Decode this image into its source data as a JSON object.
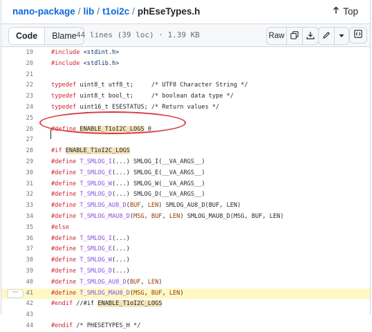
{
  "breadcrumb": {
    "parts": [
      "nano-package",
      "lib",
      "t1oi2c"
    ],
    "file": "phEseTypes.h",
    "separator": "/",
    "top_label": "Top"
  },
  "toolbar": {
    "code_tab": "Code",
    "blame_tab": "Blame",
    "meta": "44 lines (39 loc) · 1.39 KB",
    "raw_label": "Raw",
    "icons": [
      "copy-icon",
      "download-icon",
      "edit-icon",
      "chevron-down-icon",
      "symbols-panel-icon"
    ]
  },
  "code": {
    "line_numbers": [
      "19",
      "20",
      "21",
      "22",
      "23",
      "24",
      "25",
      "26",
      "27",
      "28",
      "29",
      "30",
      "31",
      "32",
      "33",
      "34",
      "35",
      "36",
      "37",
      "38",
      "39",
      "40",
      "41",
      "42",
      "43",
      "44"
    ],
    "highlighted_line": "41",
    "lines": [
      "#include <stdint.h>",
      "#include <stdlib.h>",
      "",
      "typedef uint8_t utf8_t;     /* UTF8 Character String */",
      "typedef uint8_t bool_t;     /* boolean data type */",
      "typedef uint16_t ESESTATUS; /* Return values */",
      "",
      "#define ENABLE_T1oI2C_LOGS 0",
      "",
      "#if ENABLE_T1oI2C_LOGS",
      "#define T_SMLOG_I(...) SMLOG_I(__VA_ARGS__)",
      "#define T_SMLOG_E(...) SMLOG_E(__VA_ARGS__)",
      "#define T_SMLOG_W(...) SMLOG_W(__VA_ARGS__)",
      "#define T_SMLOG_D(...) SMLOG_D(__VA_ARGS__)",
      "#define T_SMLOG_AU8_D(BUF, LEN) SMLOG_AU8_D(BUF, LEN)",
      "#define T_SMLOG_MAU8_D(MSG, BUF, LEN) SMLOG_MAU8_D(MSG, BUF, LEN)",
      "#else",
      "#define T_SMLOG_I(...)",
      "#define T_SMLOG_E(...)",
      "#define T_SMLOG_W(...)",
      "#define T_SMLOG_D(...)",
      "#define T_SMLOG_AU8_D(BUF, LEN)",
      "#define T_SMLOG_MAU8_D(MSG, BUF, LEN)",
      "#endif //#if ENABLE_T1oI2C_LOGS",
      "",
      "#endif /* PHESETYPES_H */"
    ],
    "more_button": "···"
  },
  "colors": {
    "link": "#0969da",
    "keyword": "#cf222e",
    "annotation_ellipse": "#d9363e",
    "line_highlight": "#fff8c5",
    "match_highlight": "#f3e3b8"
  }
}
